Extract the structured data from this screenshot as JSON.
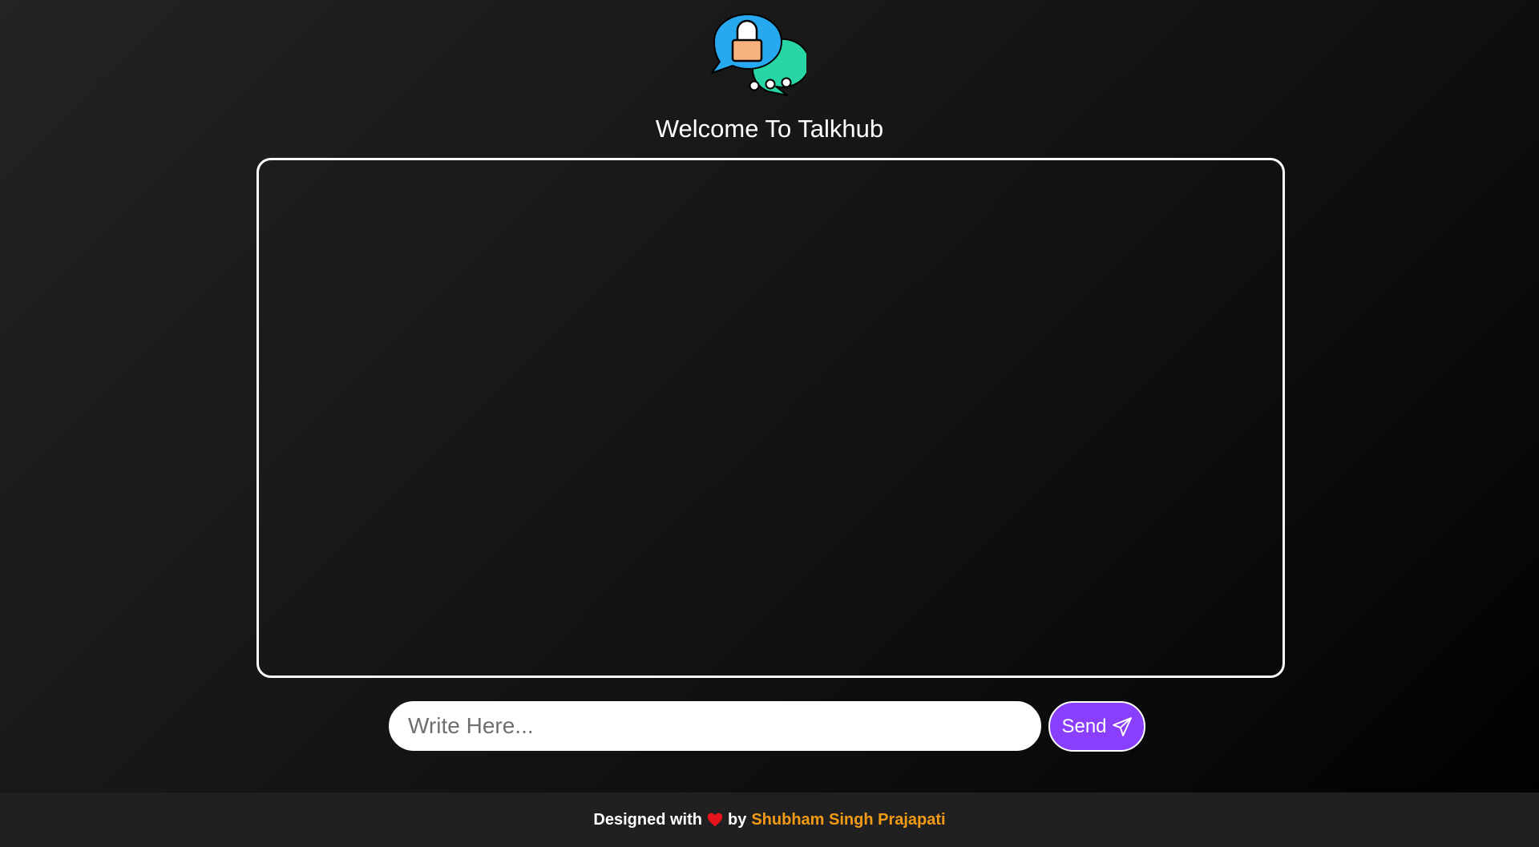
{
  "header": {
    "title": "Welcome To Talkhub",
    "logo_icon": "talkhub-chat-lock-icon"
  },
  "chat": {
    "messages": []
  },
  "composer": {
    "placeholder": "Write Here...",
    "value": "",
    "send_label": "Send",
    "send_icon": "paper-plane-icon"
  },
  "footer": {
    "prefix": "Designed with",
    "heart_icon": "heart-icon",
    "by": "by",
    "author": "Shubham Singh Prajapati"
  },
  "colors": {
    "accent": "#8a3ffc",
    "author": "#f39a16",
    "heart": "#e8141c",
    "logo_blue": "#28a8ee",
    "logo_green": "#27d6a4",
    "lock_body": "#f7b27d"
  }
}
